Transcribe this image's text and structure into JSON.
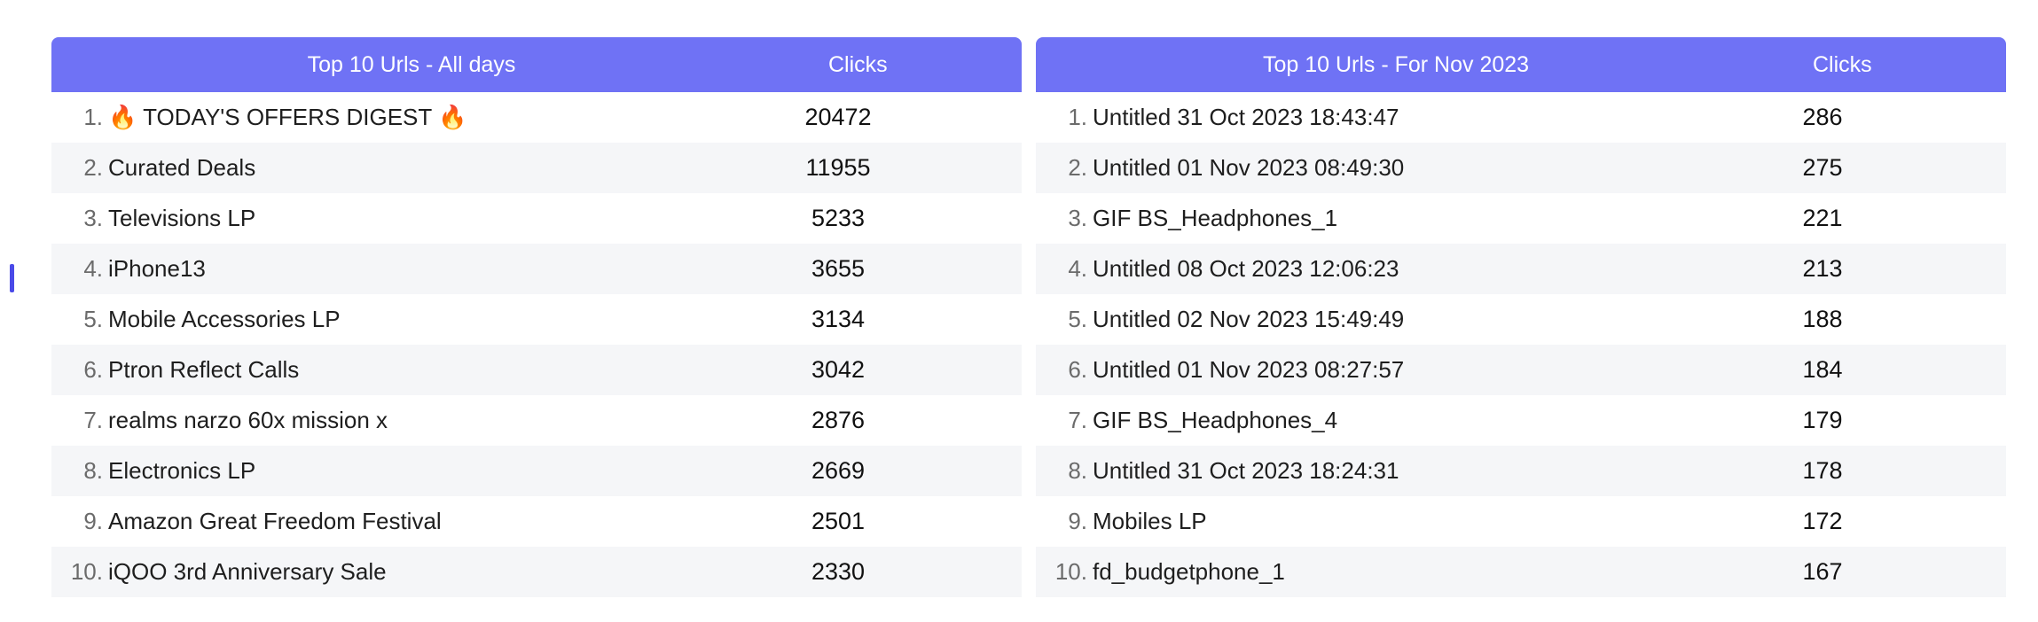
{
  "all_days": {
    "title": "Top 10 Urls - All days",
    "clicks_header": "Clicks",
    "rows": [
      {
        "index": "1.",
        "url": "🔥 TODAY'S OFFERS DIGEST 🔥",
        "clicks": "20472"
      },
      {
        "index": "2.",
        "url": "Curated Deals",
        "clicks": "11955"
      },
      {
        "index": "3.",
        "url": "Televisions LP",
        "clicks": "5233"
      },
      {
        "index": "4.",
        "url": "iPhone13",
        "clicks": "3655"
      },
      {
        "index": "5.",
        "url": "Mobile Accessories LP",
        "clicks": "3134"
      },
      {
        "index": "6.",
        "url": "Ptron Reflect Calls",
        "clicks": "3042"
      },
      {
        "index": "7.",
        "url": "realms narzo 60x mission x",
        "clicks": "2876"
      },
      {
        "index": "8.",
        "url": "Electronics LP",
        "clicks": "2669"
      },
      {
        "index": "9.",
        "url": "Amazon Great Freedom Festival",
        "clicks": "2501"
      },
      {
        "index": "10.",
        "url": "iQOO 3rd Anniversary Sale",
        "clicks": "2330"
      }
    ]
  },
  "nov_2023": {
    "title": "Top 10 Urls - For Nov 2023",
    "clicks_header": "Clicks",
    "rows": [
      {
        "index": "1.",
        "url": "Untitled 31 Oct 2023 18:43:47",
        "clicks": "286"
      },
      {
        "index": "2.",
        "url": "Untitled 01 Nov 2023 08:49:30",
        "clicks": "275"
      },
      {
        "index": "3.",
        "url": "GIF BS_Headphones_1",
        "clicks": "221"
      },
      {
        "index": "4.",
        "url": "Untitled 08 Oct 2023 12:06:23",
        "clicks": "213"
      },
      {
        "index": "5.",
        "url": "Untitled 02 Nov 2023 15:49:49",
        "clicks": "188"
      },
      {
        "index": "6.",
        "url": "Untitled 01 Nov 2023 08:27:57",
        "clicks": "184"
      },
      {
        "index": "7.",
        "url": "GIF BS_Headphones_4",
        "clicks": "179"
      },
      {
        "index": "8.",
        "url": "Untitled 31 Oct 2023 18:24:31",
        "clicks": "178"
      },
      {
        "index": "9.",
        "url": "Mobiles LP",
        "clicks": "172"
      },
      {
        "index": "10.",
        "url": "fd_budgetphone_1",
        "clicks": "167"
      }
    ]
  },
  "colors": {
    "header_bg": "#6f72f5",
    "stripe_bg": "#f5f6f8",
    "marker": "#4a4ae8"
  }
}
